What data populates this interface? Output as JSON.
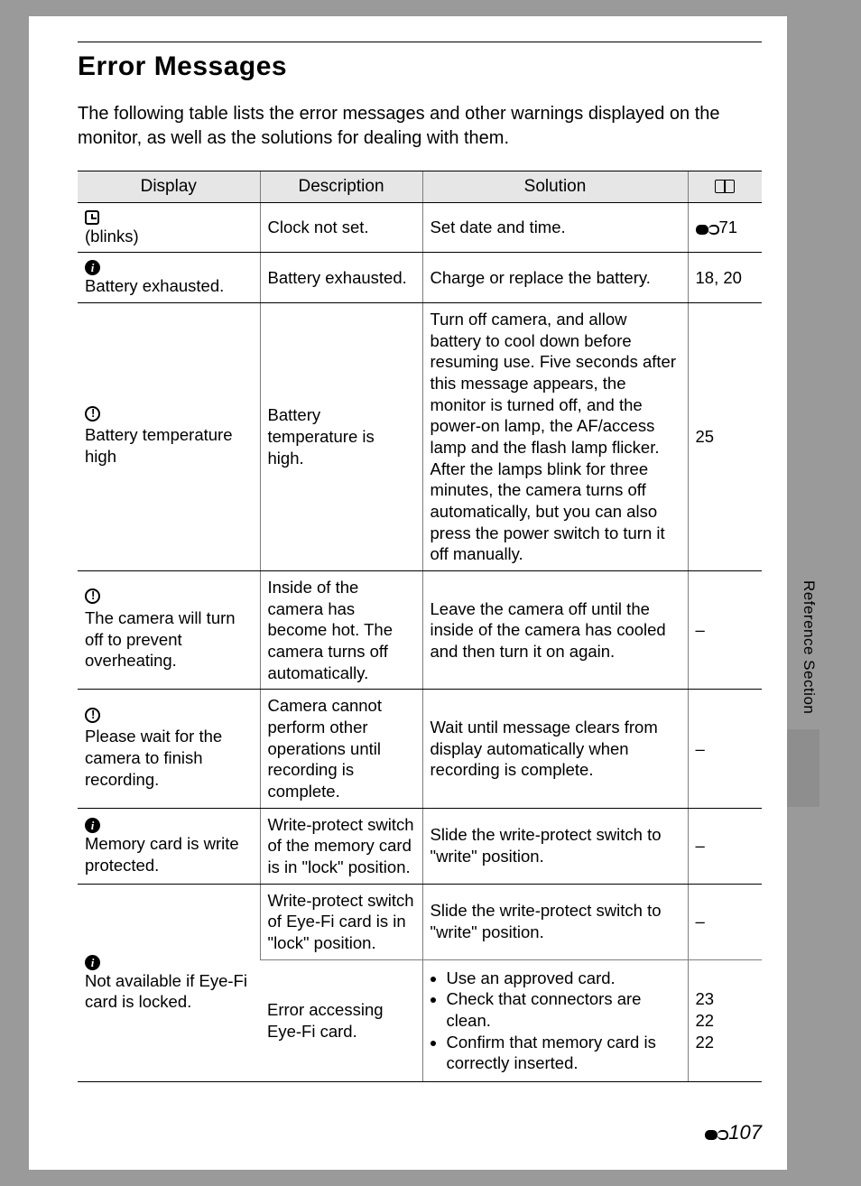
{
  "title": "Error Messages",
  "intro": "The following table lists the error messages and other warnings displayed on the monitor, as well as the solutions for dealing with them.",
  "headers": {
    "display": "Display",
    "description": "Description",
    "solution": "Solution"
  },
  "rows": {
    "r1": {
      "display_note": "(blinks)",
      "description": "Clock not set.",
      "solution": "Set date and time.",
      "ref": "71"
    },
    "r2": {
      "display_text": "Battery exhausted.",
      "description": "Battery exhausted.",
      "solution": "Charge or replace the battery.",
      "ref": "18, 20"
    },
    "r3": {
      "display_text": "Battery temperature high",
      "description": "Battery temperature is high.",
      "solution": "Turn off camera, and allow battery to cool down before resuming use. Five seconds after this message appears, the monitor is turned off, and the power-on lamp, the AF/access lamp and the flash lamp flicker. After the lamps blink for three minutes, the camera turns off automatically, but you can also press the power switch to turn it off manually.",
      "ref": "25"
    },
    "r4": {
      "display_text": "The camera will turn off to prevent overheating.",
      "description": "Inside of the camera has become hot. The camera turns off automatically.",
      "solution": "Leave the camera off until the inside of the camera has cooled and then turn it on again.",
      "ref": "–"
    },
    "r5": {
      "display_text": "Please wait for the camera to finish recording.",
      "description": "Camera cannot perform other operations until recording is complete.",
      "solution": "Wait until message clears from display automatically when recording is complete.",
      "ref": "–"
    },
    "r6": {
      "display_text": "Memory card is write protected.",
      "description": "Write-protect switch of the memory card is in \"lock\" position.",
      "solution": "Slide the write-protect switch to \"write\" position.",
      "ref": "–"
    },
    "r7": {
      "display_text": "Not available if Eye-Fi card is locked.",
      "a": {
        "description": "Write-protect switch of Eye-Fi card is in \"lock\" position.",
        "solution": "Slide the write-protect switch to \"write\" position.",
        "ref": "–"
      },
      "b": {
        "description": "Error accessing Eye-Fi card.",
        "solution_items": {
          "i1": "Use an approved card.",
          "i2": "Check that connectors are clean.",
          "i3": "Confirm that memory card is correctly inserted."
        },
        "ref_lines": {
          "l1": "23",
          "l2": "22",
          "l3": "22"
        }
      }
    }
  },
  "side_label": "Reference Section",
  "page_number": "107"
}
